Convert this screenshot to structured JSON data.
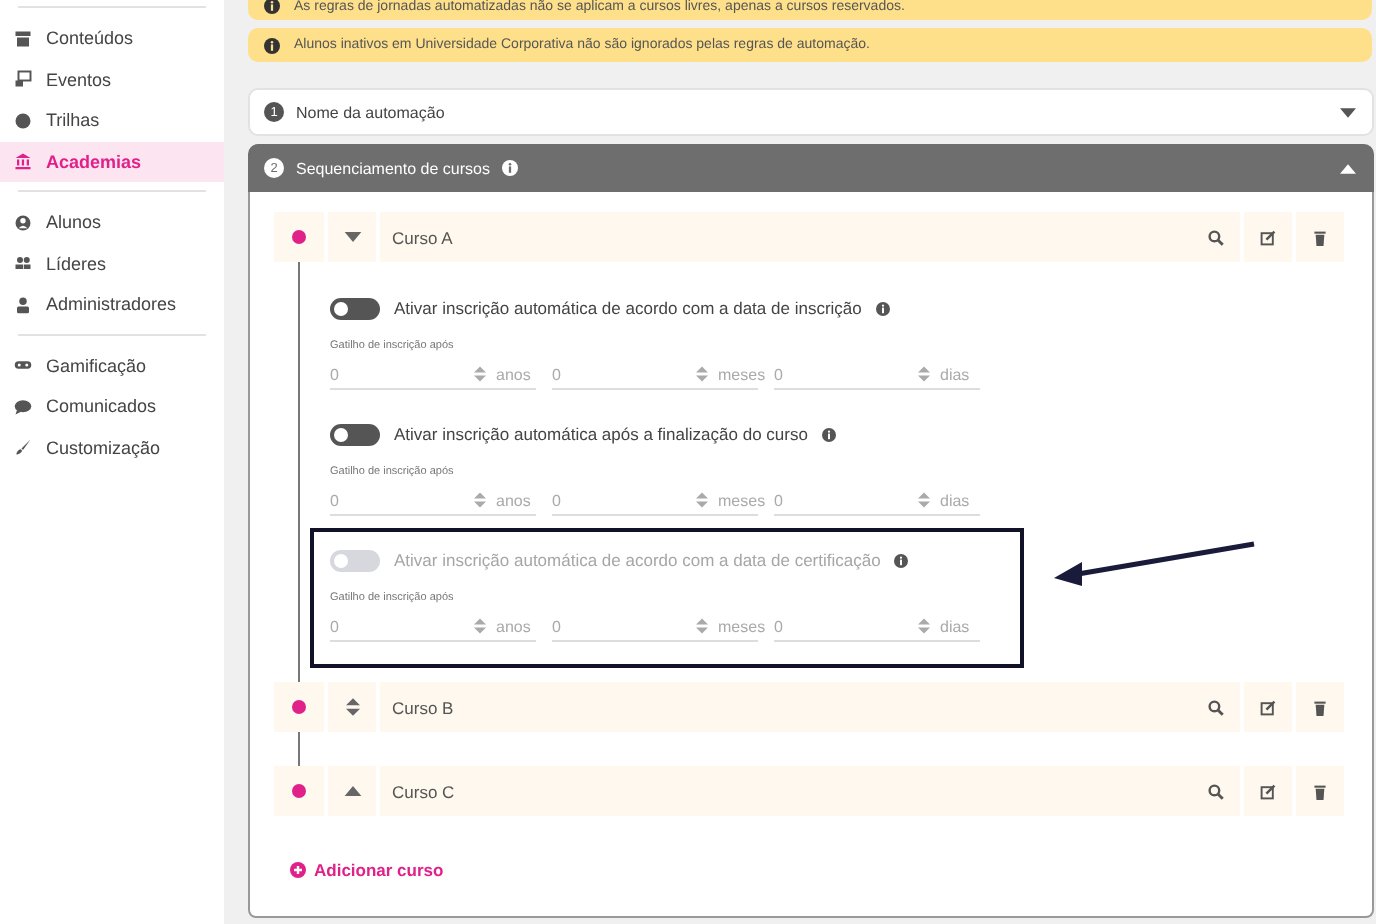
{
  "sidebar": {
    "groups": [
      [
        {
          "label": "Conteúdos",
          "selected": false
        },
        {
          "label": "Eventos",
          "selected": false
        },
        {
          "label": "Trilhas",
          "selected": false
        },
        {
          "label": "Academias",
          "selected": true
        }
      ],
      [
        {
          "label": "Alunos",
          "selected": false
        },
        {
          "label": "Líderes",
          "selected": false
        },
        {
          "label": "Administradores",
          "selected": false
        }
      ],
      [
        {
          "label": "Gamificação",
          "selected": false
        },
        {
          "label": "Comunicados",
          "selected": false
        },
        {
          "label": "Customização",
          "selected": false
        }
      ]
    ]
  },
  "banners": [
    {
      "text": "As regras de jornadas automatizadas não se aplicam a cursos livres, apenas a cursos reservados."
    },
    {
      "text": "Alunos inativos em Universidade Corporativa não são ignorados pelas regras de automação."
    }
  ],
  "steps": [
    {
      "number": "1",
      "title": "Nome da automação",
      "expanded": false,
      "info": false
    },
    {
      "number": "2",
      "title": "Sequenciamento de cursos",
      "expanded": true,
      "info": true
    }
  ],
  "courses": [
    {
      "name": "Curso A",
      "color": "#e0218a",
      "kind": "expanded",
      "options": [
        {
          "label": "Ativar inscrição automática de acordo com a data de inscrição",
          "on": false,
          "disabled": false,
          "trigger_label": "Gatilho de inscrição após",
          "fields": [
            {
              "value": "0",
              "unit": "anos"
            },
            {
              "value": "0",
              "unit": "meses"
            },
            {
              "value": "0",
              "unit": "dias"
            }
          ]
        },
        {
          "label": "Ativar inscrição automática após a finalização do curso",
          "on": false,
          "disabled": false,
          "trigger_label": "Gatilho de inscrição após",
          "fields": [
            {
              "value": "0",
              "unit": "anos"
            },
            {
              "value": "0",
              "unit": "meses"
            },
            {
              "value": "0",
              "unit": "dias"
            }
          ]
        },
        {
          "label": "Ativar inscrição automática de acordo com a data de certificação",
          "on": false,
          "disabled": true,
          "trigger_label": "Gatilho de inscrição após",
          "fields": [
            {
              "value": "0",
              "unit": "anos"
            },
            {
              "value": "0",
              "unit": "meses"
            },
            {
              "value": "0",
              "unit": "dias"
            }
          ]
        }
      ]
    },
    {
      "name": "Curso B",
      "color": "#e0218a",
      "kind": "movable"
    },
    {
      "name": "Curso C",
      "color": "#e0218a",
      "kind": "collapsed"
    }
  ],
  "add_button": {
    "label": "Adicionar curso"
  }
}
